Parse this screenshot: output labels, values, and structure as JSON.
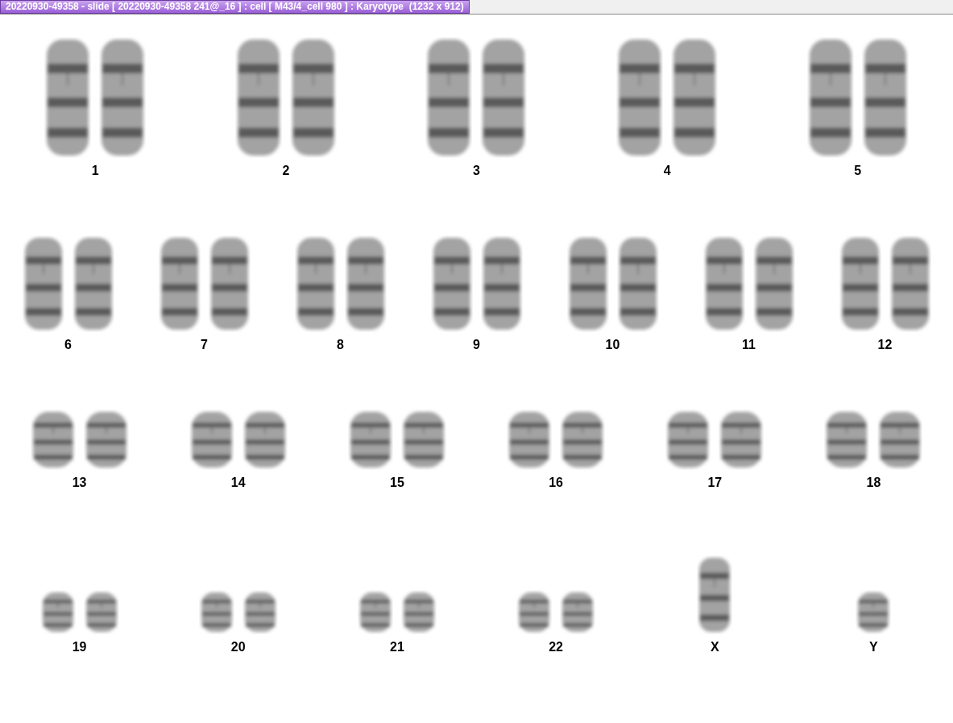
{
  "window": {
    "title": "20220930-49358 - slide [ 20220930-49358 241@_16 ] : cell [ M43/4_cell 980 ] : Karyotype  (1232 x 912)"
  },
  "karyotype_rows": [
    {
      "groups": [
        {
          "label": "1",
          "kind": "pair"
        },
        {
          "label": "2",
          "kind": "pair"
        },
        {
          "label": "3",
          "kind": "pair"
        },
        {
          "label": "4",
          "kind": "pair"
        },
        {
          "label": "5",
          "kind": "pair"
        }
      ]
    },
    {
      "groups": [
        {
          "label": "6",
          "kind": "pair"
        },
        {
          "label": "7",
          "kind": "pair"
        },
        {
          "label": "8",
          "kind": "pair"
        },
        {
          "label": "9",
          "kind": "pair"
        },
        {
          "label": "10",
          "kind": "pair"
        },
        {
          "label": "11",
          "kind": "pair"
        },
        {
          "label": "12",
          "kind": "pair"
        }
      ]
    },
    {
      "groups": [
        {
          "label": "13",
          "kind": "pair"
        },
        {
          "label": "14",
          "kind": "pair"
        },
        {
          "label": "15",
          "kind": "pair"
        },
        {
          "label": "16",
          "kind": "pair"
        },
        {
          "label": "17",
          "kind": "pair"
        },
        {
          "label": "18",
          "kind": "pair"
        }
      ]
    },
    {
      "groups": [
        {
          "label": "19",
          "kind": "pair"
        },
        {
          "label": "20",
          "kind": "pair"
        },
        {
          "label": "21",
          "kind": "pair"
        },
        {
          "label": "22",
          "kind": "pair"
        },
        {
          "label": "X",
          "kind": "single"
        },
        {
          "label": "Y",
          "kind": "single"
        }
      ]
    }
  ]
}
